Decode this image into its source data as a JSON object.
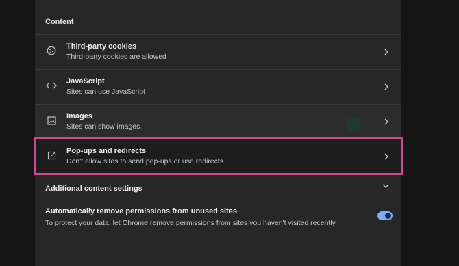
{
  "section": {
    "title": "Content"
  },
  "rows": [
    {
      "label": "Third-party cookies",
      "sub": "Third-party cookies are allowed",
      "icon": "cookie-icon"
    },
    {
      "label": "JavaScript",
      "sub": "Sites can use JavaScript",
      "icon": "code-icon"
    },
    {
      "label": "Images",
      "sub": "Sites can show images",
      "icon": "image-icon"
    },
    {
      "label": "Pop-ups and redirects",
      "sub": "Don't allow sites to send pop-ups or use redirects",
      "icon": "open-in-new-icon"
    }
  ],
  "additional": {
    "label": "Additional content settings"
  },
  "auto_remove": {
    "label": "Automatically remove permissions from unused sites",
    "sub": "To protect your data, let Chrome remove permissions from sites you haven't visited recently.",
    "enabled": true
  },
  "colors": {
    "highlight": "#d6468f",
    "toggle_on": "#7cacf8",
    "panel": "#272727",
    "background": "#151515"
  }
}
